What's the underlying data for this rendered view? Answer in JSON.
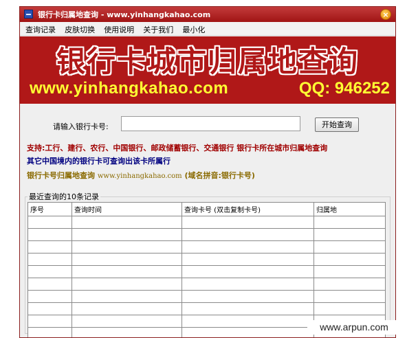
{
  "window": {
    "title": "银行卡归属地查询 - www.yinhangkahao.com",
    "close_glyph": "×"
  },
  "menu": {
    "items": [
      "查询记录",
      "皮肤切换",
      "使用说明",
      "关于我们",
      "最小化"
    ]
  },
  "banner": {
    "title": "银行卡城市归属地查询",
    "url": "www.yinhangkahao.com",
    "qq": "QQ: 946252"
  },
  "form": {
    "label": "请输入银行卡号:",
    "input_value": "",
    "button_label": "开始查询"
  },
  "info": {
    "line1": "支持:工行、建行、农行、中国银行、邮政储蓄银行、交通银行 银行卡所在城市归属地查询",
    "line2": "其它中国境内的银行卡可查询出该卡所属行",
    "line3_prefix": "银行卡号归属地查询 ",
    "line3_url": "www.yinhangkahao.com",
    "line3_suffix": " (域名拼音:银行卡号)"
  },
  "records": {
    "group_title": "最近查询的10条记录",
    "columns": [
      "序号",
      "查询时间",
      "查询卡号 (双击复制卡号)",
      "归属地"
    ],
    "rows": [
      [],
      [],
      [],
      [],
      [],
      [],
      [],
      [],
      [],
      []
    ]
  },
  "watermark": "www.arpun.com"
}
